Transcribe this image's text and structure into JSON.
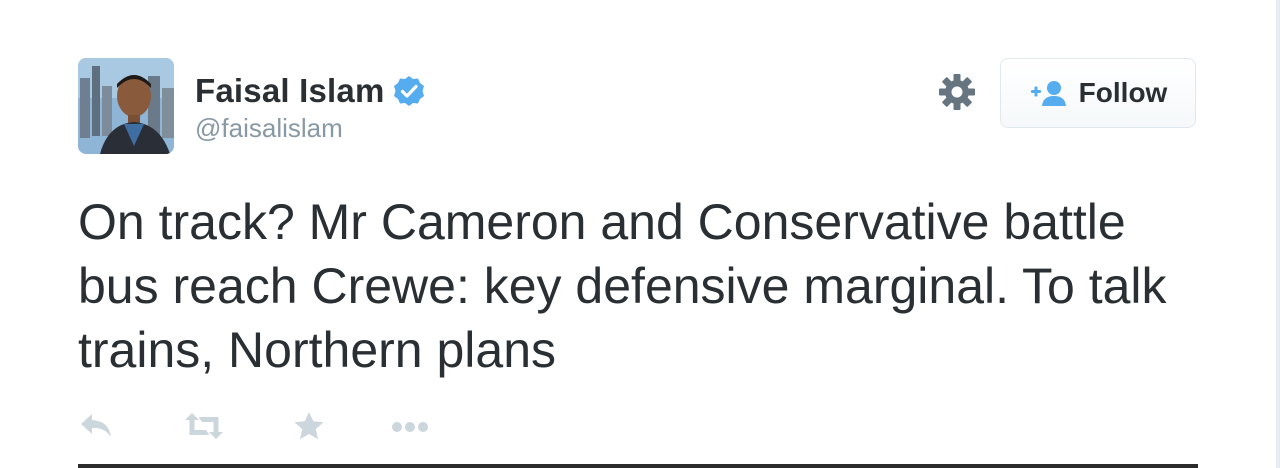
{
  "author": {
    "display_name": "Faisal Islam",
    "handle": "@faisalislam",
    "verified": true
  },
  "follow_button": {
    "label": "Follow"
  },
  "tweet": {
    "text": "On track? Mr Cameron and Conservative battle bus reach Crewe: key defensive marginal. To talk trains, Northern plans"
  },
  "actions": {
    "icons": [
      "reply-icon",
      "retweet-icon",
      "favorite-icon",
      "more-icon"
    ]
  },
  "colors": {
    "text_primary": "#292f33",
    "text_secondary": "#8899a6",
    "verified_blue": "#55acee",
    "action_gray": "#ccd6dd",
    "gear_gray": "#66757f"
  }
}
